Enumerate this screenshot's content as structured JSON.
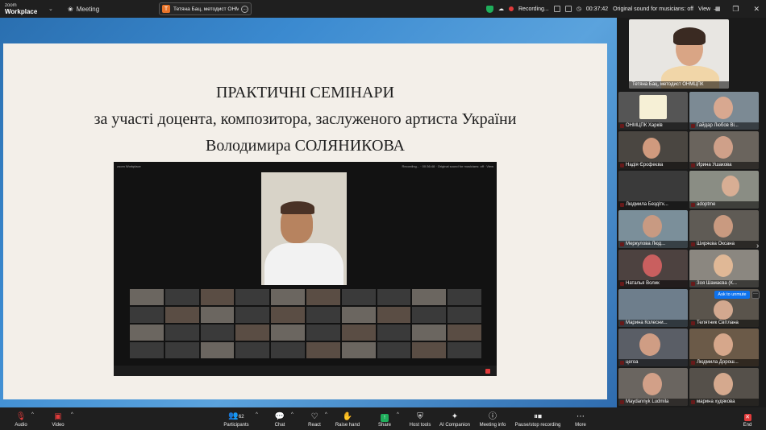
{
  "topbar": {
    "logo_small": "zoom",
    "logo_big": "Workplace",
    "meeting_label": "Meeting",
    "host_initial": "T",
    "host_name": "Тетяна Бац, методист ОНМЦПК",
    "recording_label": "Recording...",
    "timer": "00:37:42",
    "sound_label": "Original sound for musicians: off",
    "view_label": "View"
  },
  "slide": {
    "line1": "ПРАКТИЧНІ СЕМІНАРИ",
    "line2": "за участі доцента, композитора, заслуженого артиста України",
    "line3": "Володимира СОЛЯНИКОВА"
  },
  "inner": {
    "logo": "zoom Workplace",
    "status": "Recording... · 00:36:48 · Original sound for musicians: off · View"
  },
  "gallery": {
    "speaker": "Тетяна Бац, методист ОНМЦПК",
    "tiles": [
      {
        "name": "ОНМЦПК Харків"
      },
      {
        "name": "Гайдар Любов Ві..."
      },
      {
        "name": "Надія Єрофеєва"
      },
      {
        "name": "Ирина Ушакова"
      },
      {
        "name": "Людмила Бездітк..."
      },
      {
        "name": "adoptme"
      },
      {
        "name": "Меркулова Люд..."
      },
      {
        "name": "Ширяєва Оксана"
      },
      {
        "name": "Наталья Волик"
      },
      {
        "name": "Зоя Шамаєва (К..."
      },
      {
        "name": "Марина Колесни..."
      },
      {
        "name": "Телятник Світлана"
      },
      {
        "name": "цегоа"
      },
      {
        "name": "Людмила Дорош..."
      },
      {
        "name": "Maydannyk Ludmila"
      },
      {
        "name": "марина худякова"
      }
    ],
    "ask_unmute": "Ask to unmute"
  },
  "toolbar": {
    "audio": "Audio",
    "video": "Video",
    "participants": "Participants",
    "participants_count": "62",
    "chat": "Chat",
    "react": "React",
    "raise_hand": "Raise hand",
    "share": "Share",
    "host_tools": "Host tools",
    "ai_companion": "AI Companion",
    "meeting_info": "Meeting info",
    "pause_recording": "Pause/stop recording",
    "more": "More",
    "end": "End"
  },
  "colors": {
    "accent_blue": "#0e72ed",
    "record_red": "#e23b3b",
    "share_green": "#1fae5b"
  }
}
